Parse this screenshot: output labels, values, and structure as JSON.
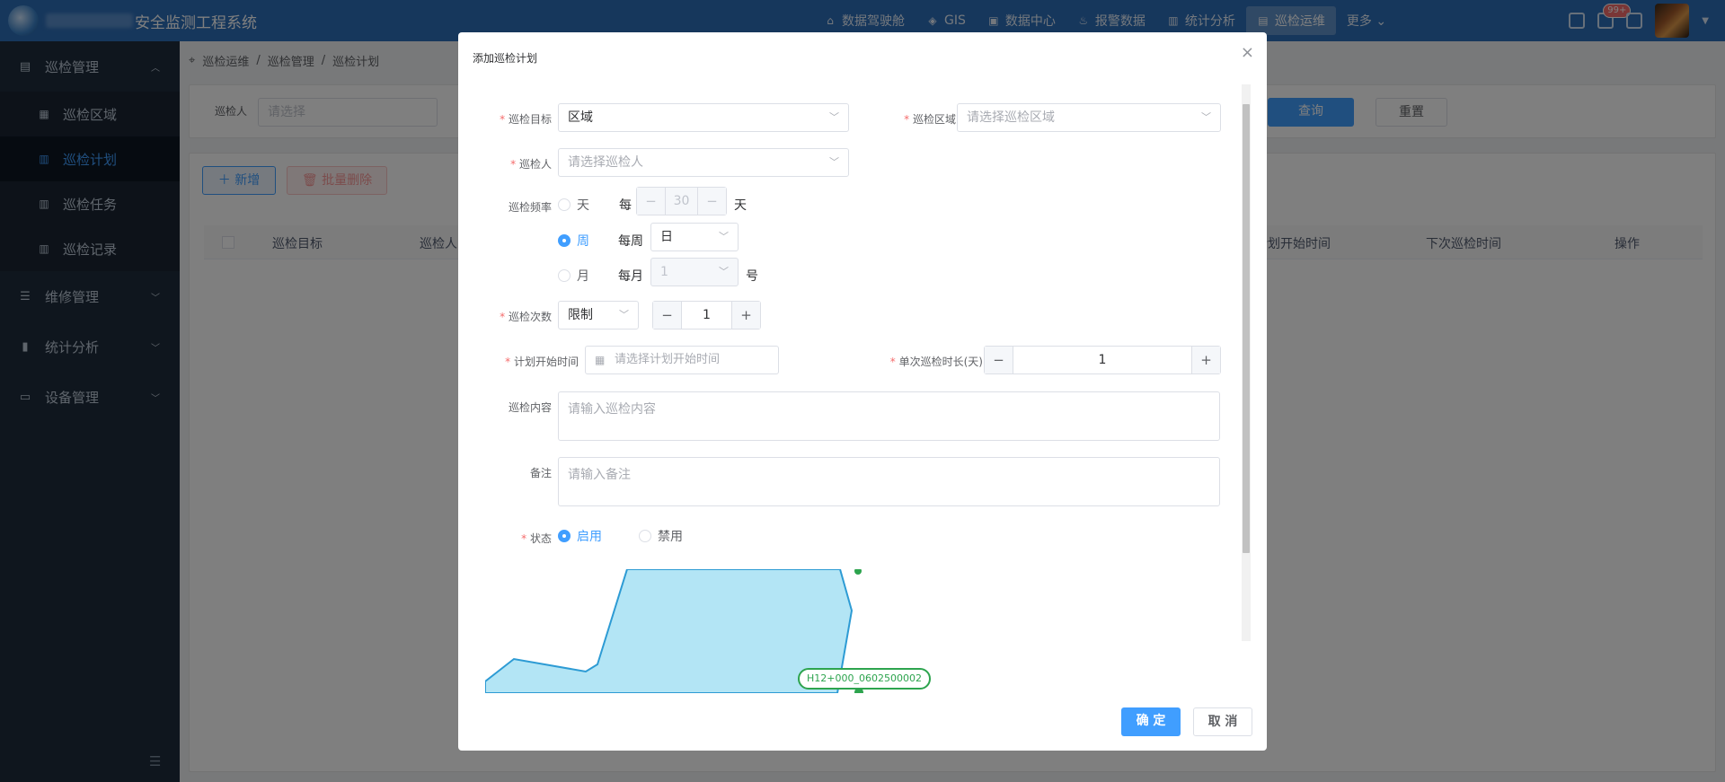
{
  "app": {
    "title_suffix": "安全监测工程系统"
  },
  "topnav": [
    {
      "icon": "cockpit-icon",
      "glyph": "⌂",
      "label": "数据驾驶舱"
    },
    {
      "icon": "gis-icon",
      "glyph": "◈",
      "label": "GIS"
    },
    {
      "icon": "data-center-icon",
      "glyph": "▣",
      "label": "数据中心"
    },
    {
      "icon": "alarm-icon",
      "glyph": "♨",
      "label": "报警数据"
    },
    {
      "icon": "stats-icon",
      "glyph": "▥",
      "label": "统计分析"
    },
    {
      "icon": "inspection-icon",
      "glyph": "▤",
      "label": "巡检运维"
    },
    {
      "icon": "more-chevron-icon",
      "glyph": "",
      "label": "更多 ⌄"
    }
  ],
  "notification_badge": "99+",
  "sidebar": {
    "groups": [
      {
        "label": "巡检管理"
      },
      {
        "label": "维修管理"
      },
      {
        "label": "统计分析"
      },
      {
        "label": "设备管理"
      }
    ],
    "sub_items": [
      {
        "label": "巡检区域"
      },
      {
        "label": "巡检计划"
      },
      {
        "label": "巡检任务"
      },
      {
        "label": "巡检记录"
      }
    ]
  },
  "breadcrumb": [
    "巡检运维",
    "/",
    "巡检管理",
    "/",
    "巡检计划"
  ],
  "search": {
    "label": "巡检人",
    "placeholder": "请选择",
    "query_label": "查询",
    "reset_label": "重置"
  },
  "toolbar": {
    "add_label": "新增",
    "batch_delete_label": "批量删除"
  },
  "table": {
    "headers": [
      "巡检目标",
      "巡检人",
      "计划开始时间",
      "下次巡检时间",
      "操作"
    ]
  },
  "dialog": {
    "title": "添加巡检计划",
    "close": "×",
    "target": {
      "label": "巡检目标",
      "value": "区域"
    },
    "area": {
      "label": "巡检区域",
      "placeholder": "请选择巡检区域"
    },
    "inspector": {
      "label": "巡检人",
      "placeholder": "请选择巡检人"
    },
    "frequency": {
      "label": "巡检频率",
      "day": {
        "radio": "天",
        "prefix": "每",
        "value": "30",
        "suffix": "天"
      },
      "week": {
        "radio": "周",
        "prefix": "每周",
        "value": "日"
      },
      "month": {
        "radio": "月",
        "prefix": "每月",
        "value": "1",
        "suffix": "号"
      }
    },
    "count": {
      "label": "巡检次数",
      "mode": "限制",
      "value": "1"
    },
    "start_time": {
      "label": "计划开始时间",
      "placeholder": "请选择计划开始时间"
    },
    "duration": {
      "label": "单次巡检时长(天)",
      "value": "1"
    },
    "content": {
      "label": "巡检内容",
      "placeholder": "请输入巡检内容"
    },
    "remark": {
      "label": "备注",
      "placeholder": "请输入备注"
    },
    "status": {
      "label": "状态",
      "enabled": "启用",
      "disabled": "禁用"
    },
    "map": {
      "marker_label": "H12+000_0602500002"
    },
    "confirm_label": "确 定",
    "cancel_label": "取 消"
  },
  "colors": {
    "primary": "#409eff",
    "topbar": "#2d6eb8",
    "sidebar": "#1f2d3d",
    "map_fill": "#b3e5f5",
    "map_stroke": "#2d9bd4",
    "marker": "#2da44e",
    "danger": "#f56c6c"
  }
}
